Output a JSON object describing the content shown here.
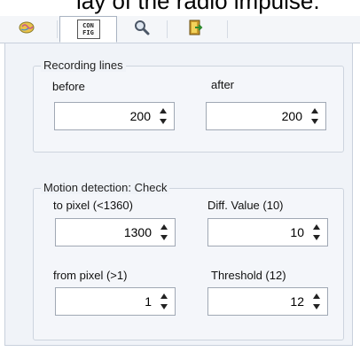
{
  "caption": "lay of the radio impulse.",
  "tabs": [
    {
      "name": "brain-icon",
      "active": false
    },
    {
      "name": "config-icon",
      "label_top": "CON",
      "label_bottom": "FIG",
      "active": true
    },
    {
      "name": "magnifier-icon",
      "active": false
    },
    {
      "name": "exit-door-icon",
      "active": false
    }
  ],
  "recording_lines": {
    "title": "Recording lines",
    "before_label": "before",
    "after_label": "after",
    "before_value": "200",
    "after_value": "200"
  },
  "motion_detection": {
    "title": "Motion detection: Check",
    "to_pixel_label": "to pixel (<1360)",
    "to_pixel_value": "1300",
    "diff_value_label": "Diff. Value (10)",
    "diff_value_value": "10",
    "from_pixel_label": "from pixel (>1)",
    "from_pixel_value": "1",
    "threshold_label": "Threshold (12)",
    "threshold_value": "12"
  }
}
